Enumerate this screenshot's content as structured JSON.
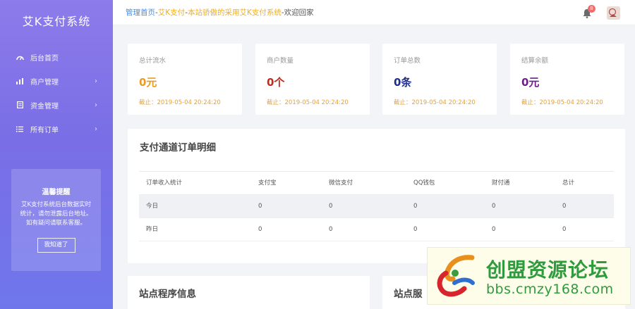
{
  "sidebar": {
    "brand": "艾K支付系统",
    "items": [
      {
        "label": "后台首页",
        "icon": "dashboard-icon"
      },
      {
        "label": "商户管理",
        "icon": "bar-chart-icon"
      },
      {
        "label": "资金管理",
        "icon": "document-icon"
      },
      {
        "label": "所有订单",
        "icon": "list-icon"
      }
    ],
    "notice": {
      "title": "温馨提醒",
      "text": "艾K支付系统后台数据实时统计，请勿泄露后台地址。如有疑问请联系客服。",
      "button": "我知道了"
    }
  },
  "header": {
    "home": "管理首页",
    "sep1": "-",
    "site": "艾K支付",
    "sep2": "-",
    "slogan": "本站骄傲的采用艾K支付系统",
    "sep3": "-",
    "welcome": "欢迎回家",
    "badge": "8"
  },
  "stats": [
    {
      "label": "总计流水",
      "value": "0元",
      "color": "#e99b27",
      "meta": "截止：2019-05-04 20:24:20"
    },
    {
      "label": "商户数量",
      "value": "0个",
      "color": "#c22a1a",
      "meta": "截止：2019-05-04 20:24:20"
    },
    {
      "label": "订单总数",
      "value": "0条",
      "color": "#1d2f8a",
      "meta": "截止：2019-05-04 20:24:20"
    },
    {
      "label": "结算余额",
      "value": "0元",
      "color": "#6c1f88",
      "meta": "截止：2019-05-04 20:24:20"
    }
  ],
  "channel_table": {
    "title": "支付通道订单明细",
    "headers": [
      "订单收入统计",
      "支付宝",
      "微信支付",
      "QQ钱包",
      "财付通",
      "总计"
    ],
    "rows": [
      [
        "今日",
        "0",
        "0",
        "0",
        "0",
        "0"
      ],
      [
        "昨日",
        "0",
        "0",
        "0",
        "0",
        "0"
      ]
    ]
  },
  "bottom_panels": [
    {
      "title": "站点程序信息"
    },
    {
      "title": "站点服"
    }
  ],
  "watermark": {
    "line1": "创盟资源论坛",
    "line2": "bbs.cmzy168.com"
  },
  "colors": {
    "accent_blue": "#3d8ef0",
    "orange": "#f0ad1e",
    "sidebar_top": "#8c7bea",
    "sidebar_bottom": "#6f76ec"
  }
}
